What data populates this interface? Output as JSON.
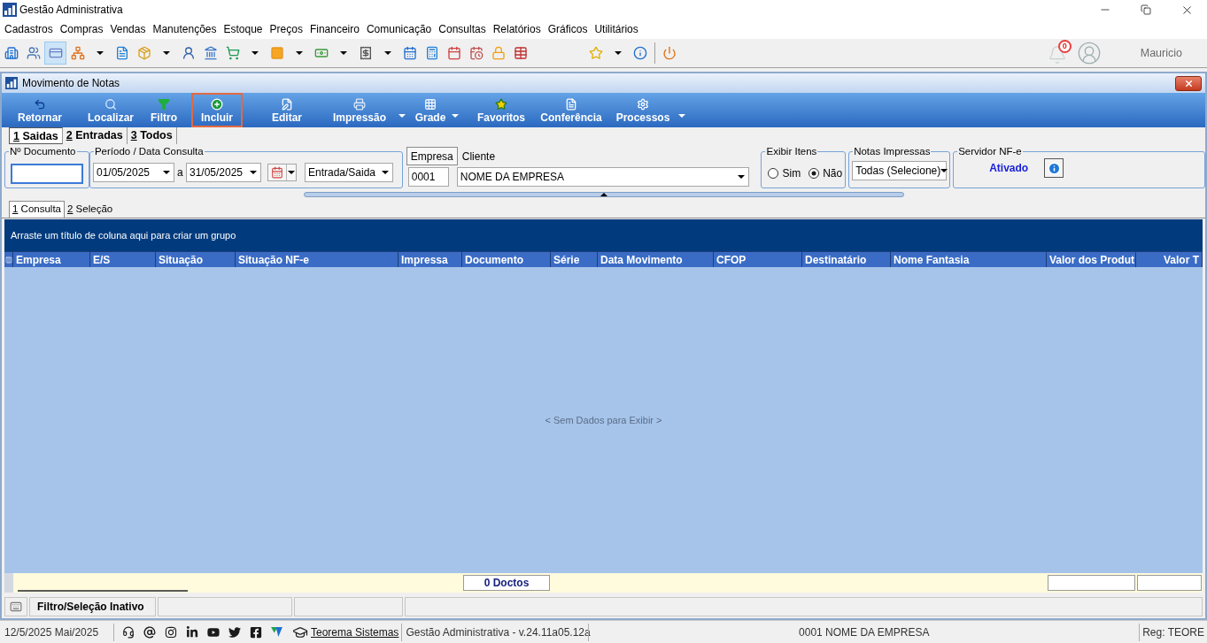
{
  "window": {
    "title": "Gestão Administrativa"
  },
  "menu": [
    "Cadastros",
    "Compras",
    "Vendas",
    "Manutenções",
    "Estoque",
    "Preços",
    "Financeiro",
    "Comunicação",
    "Consultas",
    "Relatórios",
    "Gráficos",
    "Utilitários"
  ],
  "toolbar_buttons": [
    {
      "selected": false,
      "dropdown": false
    },
    {
      "selected": false,
      "dropdown": false
    },
    {
      "selected": true,
      "dropdown": false
    },
    {
      "selected": false,
      "dropdown": true
    },
    {
      "selected": false,
      "dropdown": false
    },
    {
      "selected": false,
      "dropdown": true
    },
    {
      "selected": false,
      "dropdown": false
    },
    {
      "selected": false,
      "dropdown": false
    },
    {
      "selected": false,
      "dropdown": true
    },
    {
      "selected": false,
      "dropdown": true
    },
    {
      "selected": false,
      "dropdown": true
    },
    {
      "selected": false,
      "dropdown": true
    },
    {
      "selected": false,
      "dropdown": false
    },
    {
      "selected": false,
      "dropdown": false
    },
    {
      "selected": false,
      "dropdown": false
    },
    {
      "selected": false,
      "dropdown": false
    },
    {
      "selected": false,
      "dropdown": false
    },
    {
      "selected": false,
      "dropdown": false
    },
    {
      "selected": false,
      "dropdown": true
    },
    {
      "selected": false,
      "dropdown": false
    },
    {
      "selected": false,
      "dropdown": false
    }
  ],
  "user_area": {
    "notification_count": "0",
    "user_name": "Mauricio"
  },
  "document_window": {
    "title": "Movimento de Notas",
    "toolbar": [
      {
        "label": "Retornar",
        "selected": false,
        "dropdown": false
      },
      {
        "label": "Localizar",
        "selected": false,
        "dropdown": false
      },
      {
        "label": "Filtro",
        "selected": false,
        "dropdown": false
      },
      {
        "label": "Incluir",
        "selected": true,
        "dropdown": false
      },
      {
        "label": "Editar",
        "selected": false,
        "dropdown": false
      },
      {
        "label": "Impressão",
        "selected": false,
        "dropdown": true
      },
      {
        "label": "Grade",
        "selected": false,
        "dropdown": true
      },
      {
        "label": "Favoritos",
        "selected": false,
        "dropdown": false
      },
      {
        "label": "Conferência",
        "selected": false,
        "dropdown": false
      },
      {
        "label": "Processos",
        "selected": false,
        "dropdown": true
      }
    ],
    "tabs": [
      {
        "key": "1",
        "label": "Saidas",
        "selected": true
      },
      {
        "key": "2",
        "label": "Entradas",
        "selected": false
      },
      {
        "key": "3",
        "label": "Todos",
        "selected": false
      }
    ],
    "filters": {
      "document_number": {
        "label": "Nº Documento"
      },
      "period": {
        "label": "Período / Data Consulta",
        "from": "01/05/2025",
        "separator": "a",
        "to": "31/05/2025",
        "movement_type": "Entrada/Saida"
      },
      "party": {
        "tabs": [
          {
            "label": "Empresa",
            "selected": true
          },
          {
            "label": "Cliente",
            "selected": false
          }
        ],
        "code": "0001",
        "name": "NOME DA EMPRESA"
      },
      "show_items": {
        "label": "Exibir Itens",
        "options": [
          {
            "label": "Sim",
            "selected": false
          },
          {
            "label": "Não",
            "selected": true
          }
        ]
      },
      "printed_notes": {
        "label": "Notas Impressas",
        "value": "Todas (Selecione)"
      },
      "nfe_server": {
        "label": "Servidor NF-e",
        "status": "Ativado"
      }
    },
    "view_tabs": [
      {
        "key": "1",
        "label": "Consulta",
        "selected": true
      },
      {
        "key": "2",
        "label": "Seleção",
        "selected": false
      }
    ],
    "grid": {
      "group_hint": "Arraste um título de coluna aqui para criar um grupo",
      "columns": [
        {
          "label": "Empresa"
        },
        {
          "label": "E/S"
        },
        {
          "label": "Situação"
        },
        {
          "label": "Situação NF-e"
        },
        {
          "label": "Impressa"
        },
        {
          "label": "Documento",
          "summary": "0 Doctos"
        },
        {
          "label": "Série"
        },
        {
          "label": "Data Movimento"
        },
        {
          "label": "CFOP"
        },
        {
          "label": "Destinatário"
        },
        {
          "label": "Nome Fantasia"
        },
        {
          "label": "Valor dos Produt",
          "summary_box": true
        },
        {
          "label": "Valor T",
          "summary_box": true
        }
      ],
      "empty_text": "< Sem Dados para Exibir >"
    },
    "status_bar": {
      "filter_status": "Filtro/Seleção Inativo"
    }
  },
  "app_status_bar": {
    "date": "12/5/2025 Mai/2025",
    "company_link": "Teorema Sistemas",
    "version": "Gestão Administrativa - v.24.11a05.12a",
    "company": "0001 NOME DA EMPRESA",
    "registration": "Reg: TEORE"
  }
}
